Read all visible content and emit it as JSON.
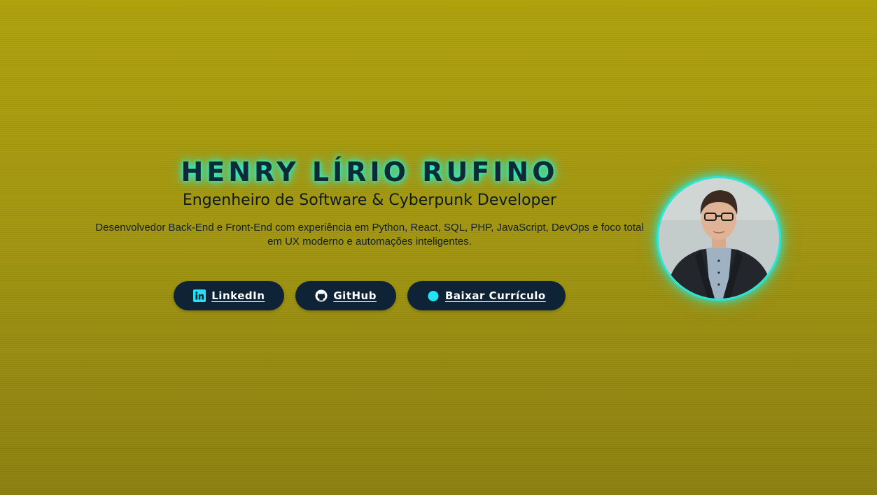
{
  "hero": {
    "name": "HENRY LÍRIO RUFINO",
    "role": "Engenheiro de Software & Cyberpunk Developer",
    "description": "Desenvolvedor Back-End e Front-End com experiência em Python, React, SQL, PHP, JavaScript, DevOps e foco total em UX moderno e automações inteligentes."
  },
  "buttons": [
    {
      "label": "LinkedIn",
      "icon": "linkedin-icon"
    },
    {
      "label": "GitHub",
      "icon": "github-icon"
    },
    {
      "label": "Baixar Currículo",
      "icon": "document-icon"
    }
  ],
  "profile": {
    "photo": "profile-photo"
  },
  "colors": {
    "background": "#a49813",
    "accent": "#21f3d6",
    "button": "#0e2436",
    "text_dark": "#0c1b1f"
  }
}
